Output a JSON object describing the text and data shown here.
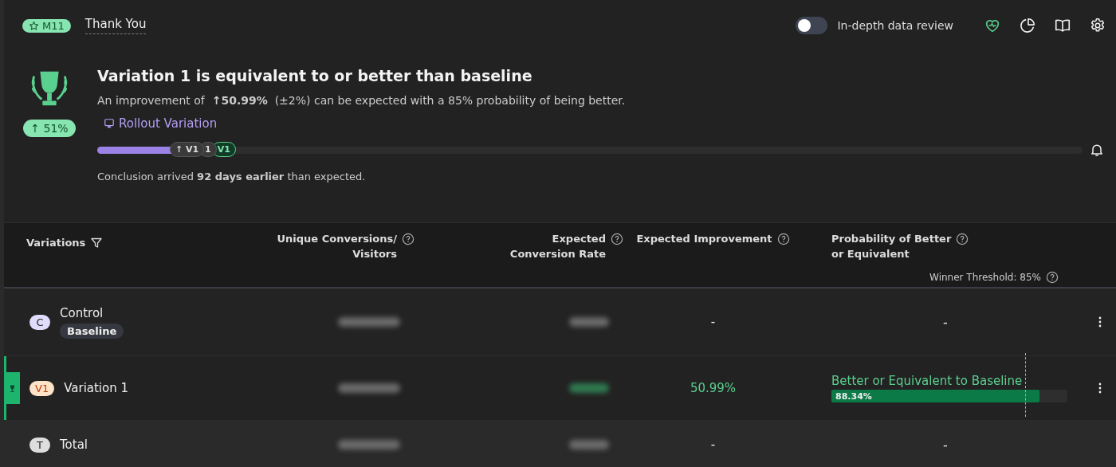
{
  "goal": {
    "badge": "M11",
    "name": "Thank You"
  },
  "toolbar": {
    "toggle": {
      "label": "In-depth data review",
      "on": false
    }
  },
  "summary": {
    "uplift_badge": "↑ 51%",
    "headline": "Variation 1 is equivalent to or better than baseline",
    "detail": "An improvement of  **↑50.99%**  (±2%) can be expected with a 85% probability of being better.",
    "rollout_button": "Rollout Variation",
    "progress": {
      "level": 0.08,
      "markers": [
        {
          "label": "↑ V1",
          "kind": "current"
        },
        {
          "label": "1",
          "kind": "hidden"
        },
        {
          "label": "V1",
          "kind": "winner"
        }
      ]
    },
    "conclusion": "Conclusion arrived **92 days earlier** than expected."
  },
  "table": {
    "columns": [
      {
        "lines": [
          "Variations"
        ],
        "kind": "filter"
      },
      {
        "lines": [
          "Unique Conversions/",
          "Visitors"
        ],
        "kind": "help"
      },
      {
        "lines": [
          "Expected",
          "Conversion Rate"
        ],
        "kind": "help"
      },
      {
        "lines": [
          "Expected Improvement"
        ],
        "kind": "help"
      },
      {
        "lines": [
          "Probability of Better",
          "or Equivalent"
        ],
        "kind": "help"
      }
    ],
    "winner_threshold": "Winner Threshold: 85%",
    "rows": [
      {
        "kind": "control",
        "badge": "C",
        "color": "#e0dcfb",
        "name": "Control",
        "tag": "Baseline",
        "winner": false,
        "rate_positive": false,
        "improvement": "-",
        "improvement_positive": false,
        "probability": {
          "kind": "dash",
          "text": "-"
        },
        "menu": true
      },
      {
        "kind": "variation",
        "badge": "V1",
        "color": "#fde3c8",
        "name": "Variation 1",
        "winner": true,
        "rate_positive": true,
        "improvement": "50.99%",
        "improvement_positive": true,
        "probability": {
          "kind": "bar",
          "label": "Better or Equivalent to Baseline",
          "value": "88.34%",
          "level": 0.8834
        },
        "menu": true
      },
      {
        "kind": "total",
        "badge": "T",
        "color": "#dddddd",
        "name": "Total",
        "winner": false,
        "rate_positive": false,
        "improvement": "-",
        "improvement_positive": false,
        "probability": {
          "kind": "dash",
          "text": "-"
        },
        "menu": false
      }
    ]
  }
}
